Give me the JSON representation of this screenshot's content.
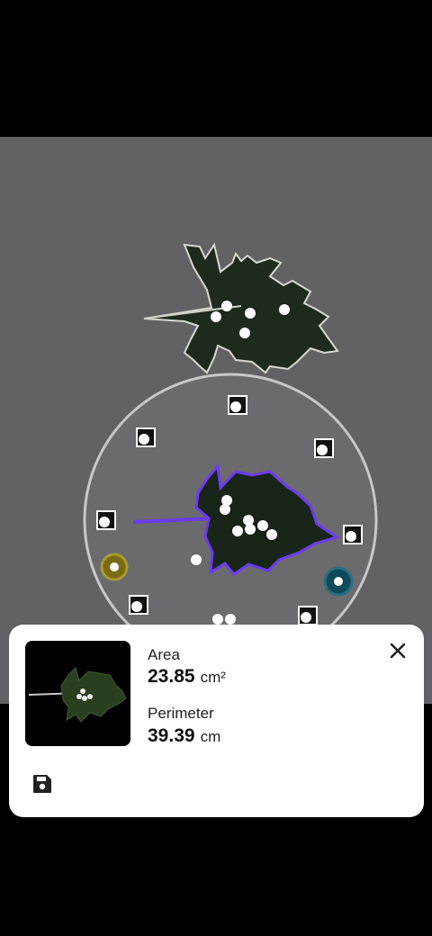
{
  "measurement": {
    "area_label": "Area",
    "area_value": "23.85",
    "area_unit": "cm²",
    "perimeter_label": "Perimeter",
    "perimeter_value": "39.39",
    "perimeter_unit": "cm"
  },
  "icons": {
    "close": "close-icon",
    "save": "save-icon"
  },
  "colors": {
    "outline": "#6a3cf0",
    "sheet_bg": "#ffffff",
    "accent_marker_yellow": "#8a7a10",
    "accent_marker_teal": "#0e4a5a"
  }
}
